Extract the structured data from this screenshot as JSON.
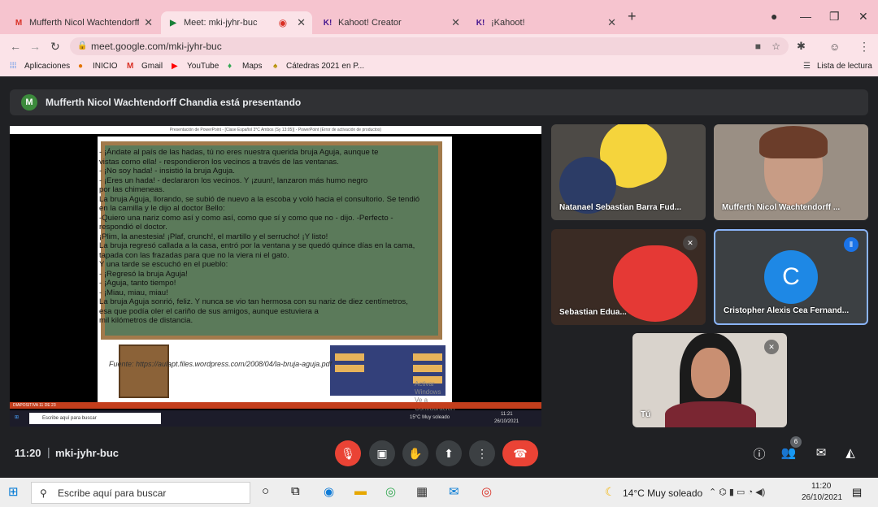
{
  "browser": {
    "tabs": [
      {
        "label": "Mufferth Nicol Wachtendorff Ch",
        "favicon": "gmail-icon",
        "color": "#d93025"
      },
      {
        "label": "Meet: mki-jyhr-buc",
        "favicon": "meet-icon",
        "color": "#188038"
      },
      {
        "label": "Kahoot! Creator",
        "favicon": "kahoot-icon",
        "color": "#46178f"
      },
      {
        "label": "¡Kahoot!",
        "favicon": "kahoot-icon",
        "color": "#46178f"
      }
    ],
    "url": "meet.google.com/mki-jyhr-buc",
    "bookmarks": [
      "Aplicaciones",
      "INICIO",
      "Gmail",
      "YouTube",
      "Maps",
      "Cátedras 2021 en P..."
    ],
    "reading_list": "Lista de lectura"
  },
  "meet": {
    "presenter_banner": "Mufferth Nicol Wachtendorff Chandia está presentando",
    "presenter_initial": "M",
    "meeting_time": "11:20",
    "meeting_code": "mki-jyhr-buc",
    "people_count": "6",
    "participants": [
      {
        "name": "Natanael Sebastian Barra Fud..."
      },
      {
        "name": "Mufferth Nicol Wachtendorff ..."
      },
      {
        "name": "Sebastian Edua..."
      },
      {
        "name": "Cristopher Alexis Cea Fernand...",
        "initial": "C"
      },
      {
        "name": "Tú"
      }
    ]
  },
  "shared_screen": {
    "ppt_title": "Presentación de PowerPoint - [Clase Español 3°C Ambos (Sy 13:05)] - PowerPoint (Error de activación de productos)",
    "slide_lines": [
      "-   ¡Ándate al país de las hadas, tú no eres nuestra querida bruja Aguja, aunque te",
      "    vistas como ella! - respondieron los vecinos a través de las ventanas.",
      "    - ¡No soy hada! - insistió la bruja Aguja.",
      "    - ¡Eres un hada! - declararon los vecinos. Y ¡zuun!, lanzaron más humo negro",
      "    por las chimeneas.",
      "La bruja Aguja, llorando, se subió de nuevo a la escoba y voló hacia el consultorio. Se tendió",
      "en la camilla y le dijo al doctor Bello:",
      "-Quiero una nariz como así y como así, como que sí y como que no - dijo. -Perfecto -",
      "respondió el doctor.",
      "¡Plim, la anestesia! ¡Plaf, crunch!, el martillo y el serrucho! ¡Y listo!",
      "La bruja regresó callada a la casa, entró por la ventana y se quedó quince días en la cama,",
      "tapada con las frazadas para que no la viera ni el gato.",
      "Y una tarde se escuchó en el pueblo:",
      "- ¡Regresó la bruja Aguja!",
      "- ¡Aguja, tanto tiempo!",
      "- ¡Miau, miau, miau!",
      "La bruja Aguja sonrió, feliz. Y nunca se vio tan hermosa con su nariz de diez centímetros,",
      "esa que podía oler el cariño de sus amigos, aunque estuviera a",
      "mil kilómetros de distancia."
    ],
    "source_link": "Fuente: https://aulapt.files.wordpress.com/2008/04/la-bruja-aguja.pdf",
    "activation_watermark": [
      "Activar Windows",
      "Ve a Configuración para activar Windows."
    ],
    "slide_status": "DIAPOSITIVA 11 DE 23",
    "inner_search": "Escribe aquí para buscar",
    "inner_weather": "15°C  Muy soleado",
    "inner_time": "11:21",
    "inner_date": "26/10/2021"
  },
  "taskbar": {
    "search_placeholder": "Escribe aquí para buscar",
    "weather": "14°C  Muy soleado",
    "time": "11:20",
    "date": "26/10/2021"
  }
}
